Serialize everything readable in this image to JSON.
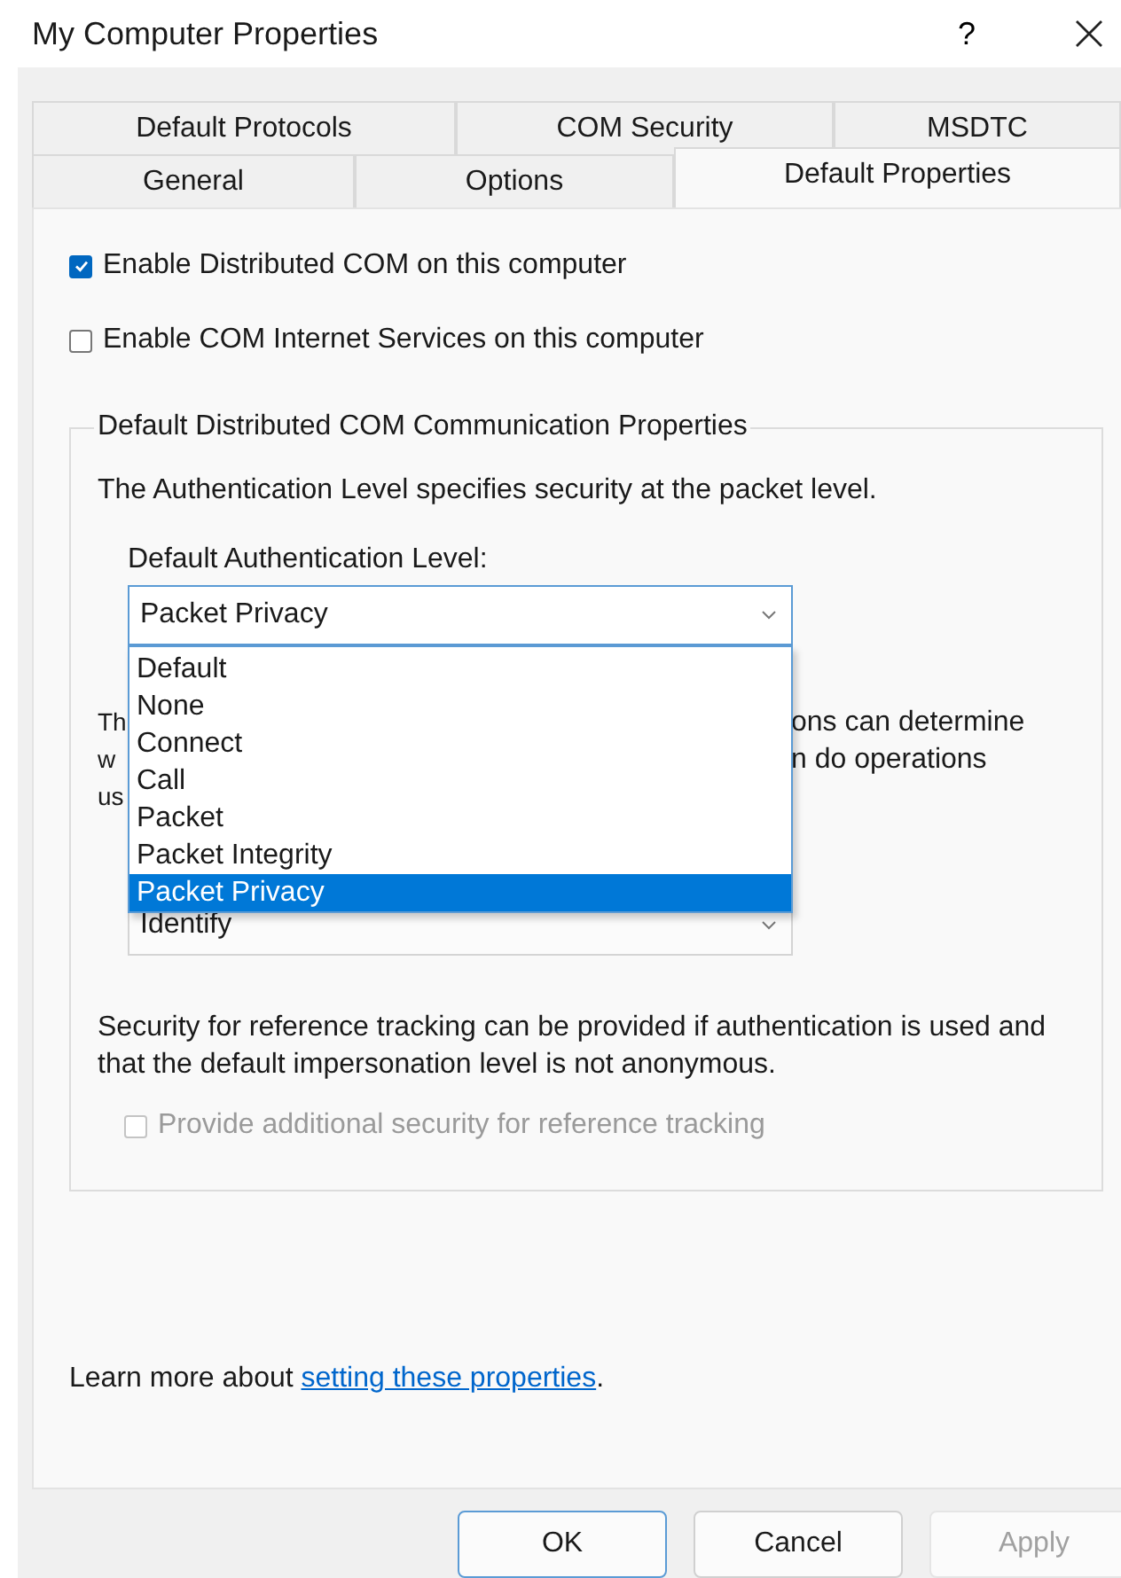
{
  "window": {
    "title": "My Computer Properties",
    "help": "?"
  },
  "tabs": [
    [
      {
        "label": "Default Protocols",
        "selected": false
      },
      {
        "label": "COM Security",
        "selected": false
      },
      {
        "label": "MSDTC",
        "selected": false
      }
    ],
    [
      {
        "label": "General",
        "selected": false
      },
      {
        "label": "Options",
        "selected": false
      },
      {
        "label": "Default Properties",
        "selected": true
      }
    ]
  ],
  "checkboxes": [
    {
      "label": "Enable Distributed COM on this computer",
      "checked": true
    },
    {
      "label": "Enable COM Internet Services on this computer",
      "checked": false
    }
  ],
  "group": {
    "legend": "Default Distributed COM Communication Properties",
    "intro": "The Authentication Level specifies security at the packet level.",
    "auth_label": "Default Authentication Level:",
    "auth_combo": {
      "value": "Packet Privacy",
      "open": true,
      "options": [
        {
          "label": "Default",
          "selected": false
        },
        {
          "label": "None",
          "selected": false
        },
        {
          "label": "Connect",
          "selected": false
        },
        {
          "label": "Call",
          "selected": false
        },
        {
          "label": "Packet",
          "selected": false
        },
        {
          "label": "Packet Integrity",
          "selected": false
        },
        {
          "label": "Packet Privacy",
          "selected": true
        }
      ]
    },
    "covered_text_left": [
      "Th",
      "w",
      "us"
    ],
    "covered_text_right": [
      "ons can determine",
      "n do operations"
    ],
    "impersonation_combo": {
      "value": "Identify"
    },
    "tracking_text": "Security for reference tracking can be provided if authentication is used and that the default impersonation level is not anonymous.",
    "tracking_checkbox": {
      "label": "Provide additional security for reference tracking",
      "checked": false,
      "disabled": true
    }
  },
  "learn_more": {
    "text": "Learn more about ",
    "link": "setting these properties",
    "end": "."
  },
  "buttons": [
    {
      "label": "OK",
      "default": true,
      "disabled": false
    },
    {
      "label": "Cancel",
      "default": false,
      "disabled": false
    },
    {
      "label": "Apply",
      "default": false,
      "disabled": true
    }
  ]
}
